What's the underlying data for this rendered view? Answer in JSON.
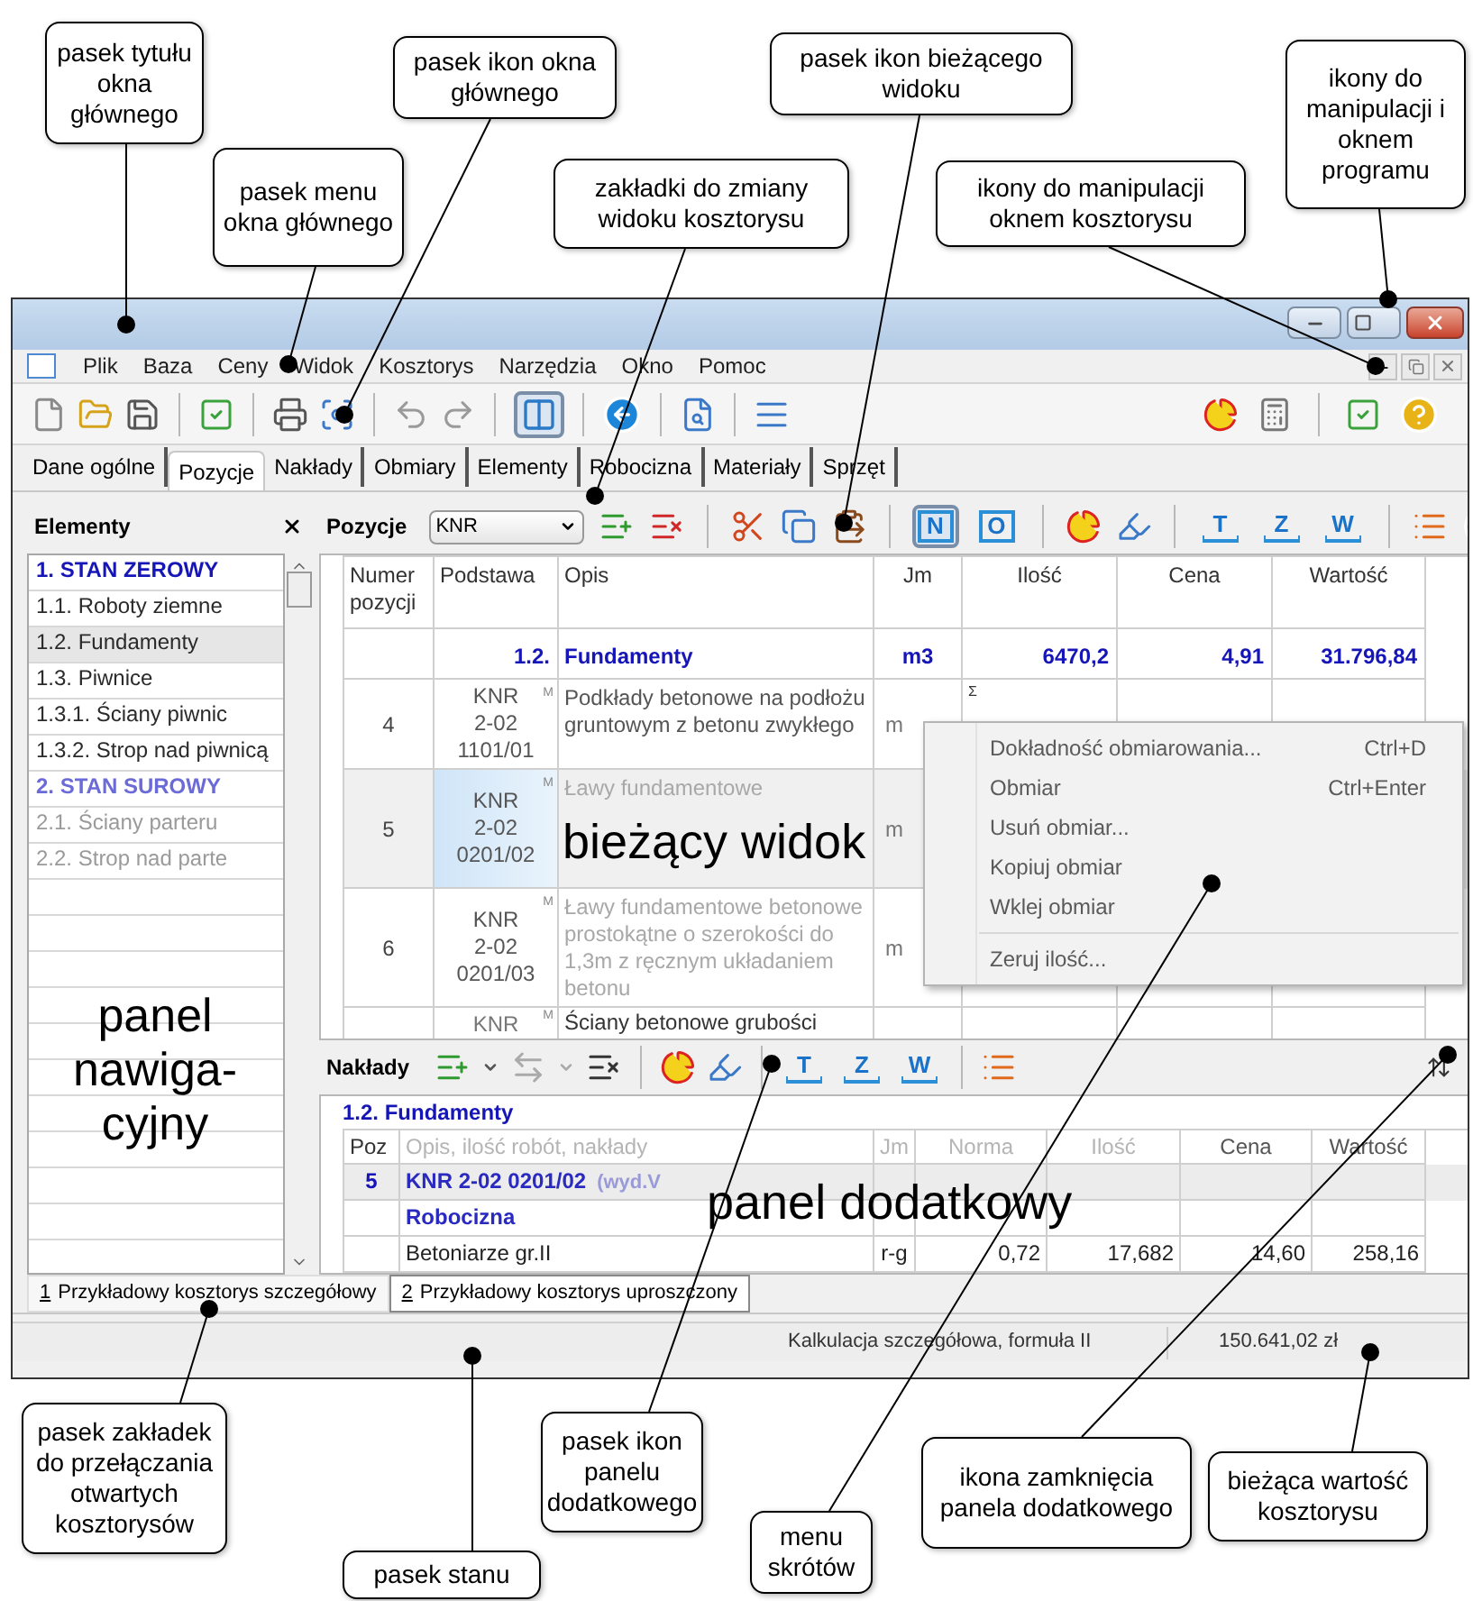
{
  "menu": [
    "Plik",
    "Baza",
    "Ceny",
    "Widok",
    "Kosztorys",
    "Narzędzia",
    "Okno",
    "Pomoc"
  ],
  "toolbar": {
    "layout_pressed": true
  },
  "tabs": [
    {
      "label": "Dane ogólne",
      "selected": false
    },
    {
      "label": "Pozycje",
      "selected": true
    },
    {
      "label": "Nakłady",
      "selected": false
    },
    {
      "label": "Obmiary",
      "selected": false
    },
    {
      "label": "Elementy",
      "selected": false
    },
    {
      "label": "Robocizna",
      "selected": false
    },
    {
      "label": "Materiały",
      "selected": false
    },
    {
      "label": "Sprzęt",
      "selected": false
    }
  ],
  "navigation": {
    "title": "Elementy",
    "items": [
      {
        "text": "1. STAN ZEROWY",
        "kind": "heading",
        "selected": false,
        "disabled": false
      },
      {
        "text": "1.1. Roboty ziemne",
        "kind": "item",
        "selected": false,
        "disabled": false
      },
      {
        "text": "1.2. Fundamenty",
        "kind": "item",
        "selected": true,
        "disabled": false
      },
      {
        "text": "1.3. Piwnice",
        "kind": "item",
        "selected": false,
        "disabled": false
      },
      {
        "text": "1.3.1. Ściany piwnic",
        "kind": "item",
        "selected": false,
        "disabled": false
      },
      {
        "text": "1.3.2. Strop nad piwnicą",
        "kind": "item",
        "selected": false,
        "disabled": false
      },
      {
        "text": "2. STAN SUROWY",
        "kind": "heading",
        "selected": false,
        "disabled": true
      },
      {
        "text": "2.1. Ściany parteru",
        "kind": "item",
        "selected": false,
        "disabled": true
      },
      {
        "text": "2.2. Strop nad parte",
        "kind": "item",
        "selected": false,
        "disabled": true
      }
    ]
  },
  "view_toolbar": {
    "title": "Pozycje",
    "select_value": "KNR",
    "letter_buttons": [
      {
        "letter": "N",
        "selected": true
      },
      {
        "letter": "O",
        "selected": false
      }
    ],
    "level_buttons": [
      "T",
      "Z",
      "W"
    ]
  },
  "table": {
    "columns": [
      "Numer pozycji",
      "Podstawa",
      "Opis",
      "Jm",
      "Ilość",
      "Cena",
      "Wartość"
    ],
    "rows": [
      {
        "kind": "section",
        "podstawa": "1.2.",
        "opis": "Fundamenty",
        "jm": "m3",
        "ilosc": "6470,2",
        "cena": "4,91",
        "wartosc": "31.796,84"
      },
      {
        "kind": "position",
        "numer": "4",
        "podstawa": [
          "KNR",
          "2-02",
          "1101/01"
        ],
        "flag": "M",
        "opis": "Podkłady betonowe na podłożu gruntowym z betonu zwykłego",
        "jm": "m",
        "mark": "Σ",
        "selected": false,
        "dimmed": false
      },
      {
        "kind": "position",
        "numer": "5",
        "podstawa": [
          "KNR",
          "2-02",
          "0201/02"
        ],
        "flag": "M",
        "opis": "Ławy fundamentowe",
        "jm": "m",
        "selected": true,
        "dimmed": true
      },
      {
        "kind": "position",
        "numer": "6",
        "podstawa": [
          "KNR",
          "2-02",
          "0201/03"
        ],
        "flag": "M",
        "opis": "Ławy fundamentowe betonowe prostokątne o szerokości do 1,3m z ręcznym układaniem betonu",
        "jm": "m",
        "selected": false,
        "dimmed": true
      },
      {
        "kind": "partial",
        "podstawa": [
          "KNR"
        ],
        "flag": "M",
        "opis": "Ściany betonowe grubości"
      }
    ]
  },
  "context_menu": [
    {
      "label": "Dokładność obmiarowania...",
      "shortcut": "Ctrl+D",
      "separator_before": false
    },
    {
      "label": "Obmiar",
      "shortcut": "Ctrl+Enter",
      "separator_before": false
    },
    {
      "label": "Usuń obmiar...",
      "separator_before": false
    },
    {
      "label": "Kopiuj obmiar",
      "separator_before": false
    },
    {
      "label": "Wklej obmiar",
      "separator_before": false
    },
    {
      "label": "Zeruj ilość...",
      "separator_before": true
    }
  ],
  "naklady": {
    "title": "Nakłady",
    "letters": [
      "T",
      "Z",
      "W"
    ],
    "section": "1.2. Fundamenty",
    "columns": [
      "Poz",
      "Opis, ilość robót, nakłady",
      "Jm",
      "Norma",
      "Ilość",
      "Cena",
      "Wartość"
    ],
    "rows": [
      {
        "kind": "position",
        "poz": "5",
        "opis": "KNR 2-02   0201/02",
        "note": "(wyd.V"
      },
      {
        "kind": "group",
        "opis": "Robocizna"
      },
      {
        "kind": "resource",
        "opis": "Betoniarze gr.II",
        "jm": "r-g",
        "norma": "0,72",
        "ilosc": "17,682",
        "cena": "14,60",
        "wartosc": "258,16"
      }
    ]
  },
  "document_tabs": [
    {
      "number": "1",
      "label": "Przykładowy kosztorys szczegółowy",
      "selected": true
    },
    {
      "number": "2",
      "label": "Przykładowy kosztorys uproszczony",
      "selected": false
    }
  ],
  "status_bar": {
    "calculation": "Kalkulacja szczegółowa, formuła II",
    "value": "150.641,02 zł"
  },
  "overlay_labels": [
    "bieżący widok",
    "panel nawiga-cyjny",
    "panel dodatkowy"
  ],
  "annotations": [
    "pasek tytułu okna głównego",
    "pasek menu okna głównego",
    "pasek ikon okna głównego",
    "zakładki do zmiany widoku kosztorysu",
    "pasek ikon bieżącego widoku",
    "ikony do manipulacji oknem kosztorysu",
    "ikony do manipulacji i oknem programu",
    "pasek zakładek do przełączania otwartych kosztorysów",
    "pasek stanu",
    "pasek ikon panelu dodatkowego",
    "menu skrótów",
    "ikona zamknięcia panela dodatkowego",
    "bieżąca wartość kosztorysu"
  ]
}
